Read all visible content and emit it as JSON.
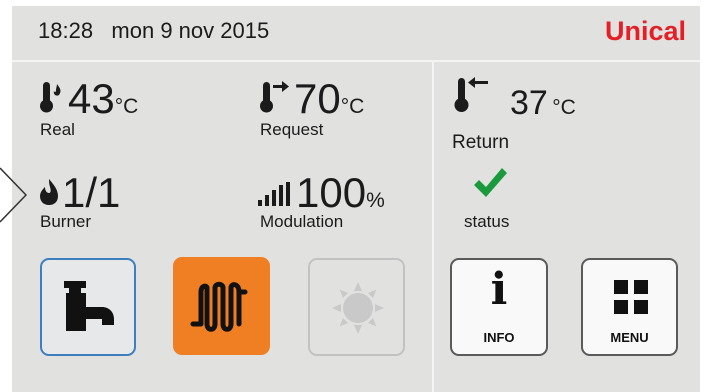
{
  "header": {
    "time": "18:28",
    "date": "mon 9 nov 2015",
    "brand": "Unical"
  },
  "metrics": {
    "real": {
      "value": "43",
      "unit": "°C",
      "label": "Real",
      "icon": "thermometer-flame-icon"
    },
    "request": {
      "value": "70",
      "unit": "°C",
      "label": "Request",
      "icon": "thermometer-arrow-icon"
    },
    "burner": {
      "value": "1/1",
      "label": "Burner",
      "icon": "flame-icon"
    },
    "modulation": {
      "value": "100",
      "unit": "%",
      "label": "Modulation",
      "icon": "signal-bars-icon"
    },
    "return": {
      "value": "37",
      "unit": "°C",
      "label": "Return",
      "icon": "thermometer-return-icon"
    },
    "status": {
      "label": "status",
      "icon": "checkmark-icon"
    }
  },
  "buttons": {
    "hot_water": {
      "icon": "tap-icon"
    },
    "heating": {
      "icon": "radiator-icon"
    },
    "summer": {
      "icon": "sun-icon"
    },
    "info": {
      "label": "INFO",
      "glyph": "i",
      "icon": "info-icon"
    },
    "menu": {
      "label": "MENU",
      "icon": "grid-icon"
    }
  },
  "colors": {
    "brand": "#e41f26",
    "panel": "#e1e2e0",
    "tap_border": "#3e7ebf",
    "heating": "#f07f23",
    "status_ok": "#1a9a3c"
  }
}
